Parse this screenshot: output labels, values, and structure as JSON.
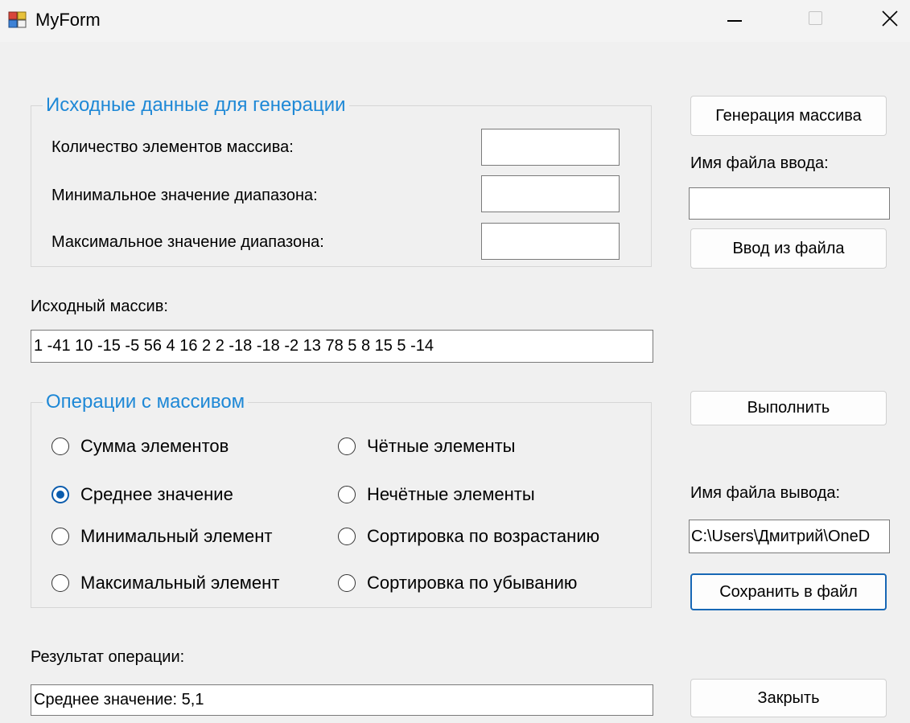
{
  "window": {
    "title": "MyForm"
  },
  "generation": {
    "legend": "Исходные данные для генерации",
    "count_label": "Количество элементов массива:",
    "min_label": "Минимальное значение диапазона:",
    "max_label": "Максимальное значение диапазона:",
    "count_value": "",
    "min_value": "",
    "max_value": ""
  },
  "side": {
    "generate_button": "Генерация массива",
    "input_file_label": "Имя файла ввода:",
    "input_file_value": "",
    "load_button": "Ввод из файла",
    "run_button": "Выполнить",
    "output_file_label": "Имя файла вывода:",
    "output_file_value": "C:\\Users\\Дмитрий\\OneD",
    "save_button": "Сохранить в файл",
    "close_button": "Закрыть"
  },
  "array": {
    "label": "Исходный массив:",
    "value": "1 -41 10 -15 -5 56 4 16 2 2 -18 -18 -2 13 78 5 8 15 5 -14"
  },
  "operations": {
    "legend": "Операции с массивом",
    "options": [
      {
        "label": "Сумма элементов",
        "checked": false
      },
      {
        "label": "Среднее значение",
        "checked": true
      },
      {
        "label": "Минимальный элемент",
        "checked": false
      },
      {
        "label": "Максимальный элемент",
        "checked": false
      },
      {
        "label": "Чётные элементы",
        "checked": false
      },
      {
        "label": "Нечётные элементы",
        "checked": false
      },
      {
        "label": "Сортировка по возрастанию",
        "checked": false
      },
      {
        "label": "Сортировка по убыванию",
        "checked": false
      }
    ]
  },
  "result": {
    "label": "Результат операции:",
    "value": "Среднее значение: 5,1"
  }
}
